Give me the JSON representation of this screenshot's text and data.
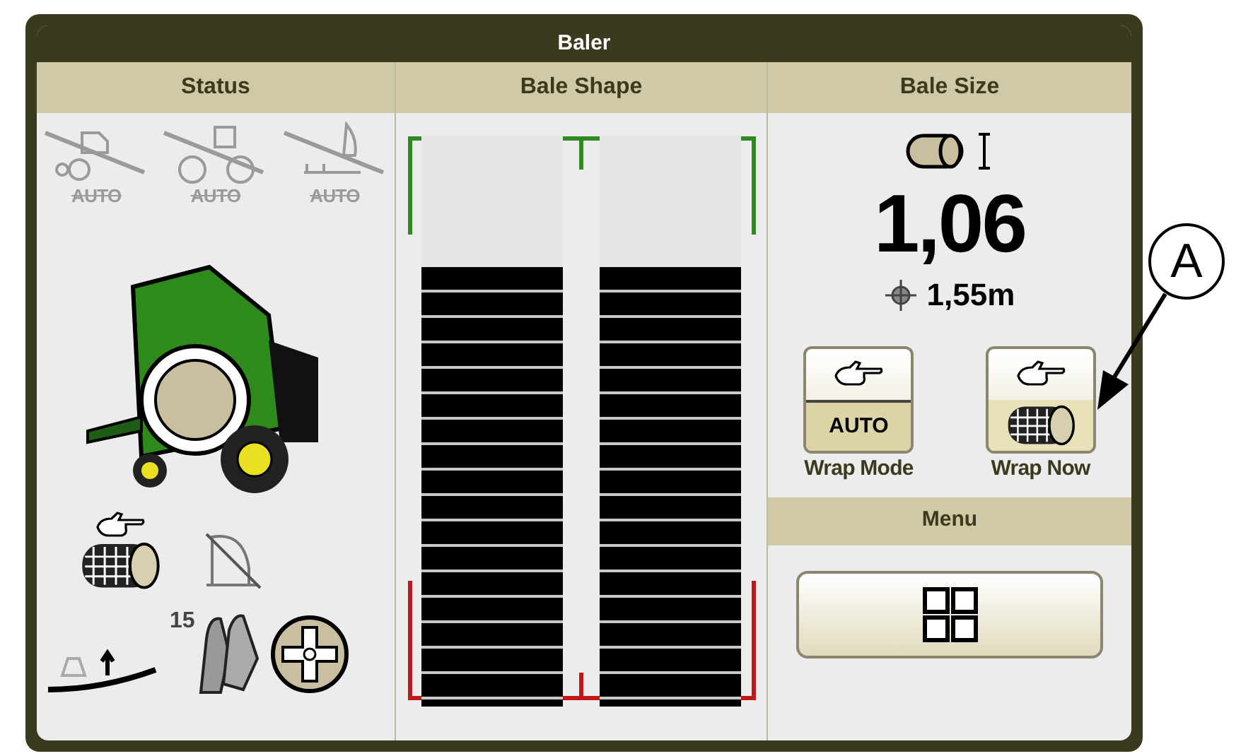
{
  "window": {
    "title": "Baler"
  },
  "columns": [
    {
      "heading": "Status"
    },
    {
      "heading": "Bale Shape"
    },
    {
      "heading": "Bale Size"
    }
  ],
  "status": {
    "automation": [
      {
        "label": "AUTO",
        "on": false
      },
      {
        "label": "AUTO",
        "on": false
      },
      {
        "label": "AUTO",
        "on": false
      }
    ],
    "bale_count": "15"
  },
  "bale_shape": {
    "left": {
      "level": 0.77
    },
    "right": {
      "level": 0.77
    }
  },
  "bale_size": {
    "value": "1,06",
    "diameter": "1,55m"
  },
  "buttons": [
    {
      "kind": "mode",
      "badge": "AUTO",
      "label": "Wrap Mode"
    },
    {
      "kind": "action",
      "label": "Wrap Now"
    }
  ],
  "menu": {
    "heading": "Menu"
  },
  "callout": {
    "label": "A"
  }
}
